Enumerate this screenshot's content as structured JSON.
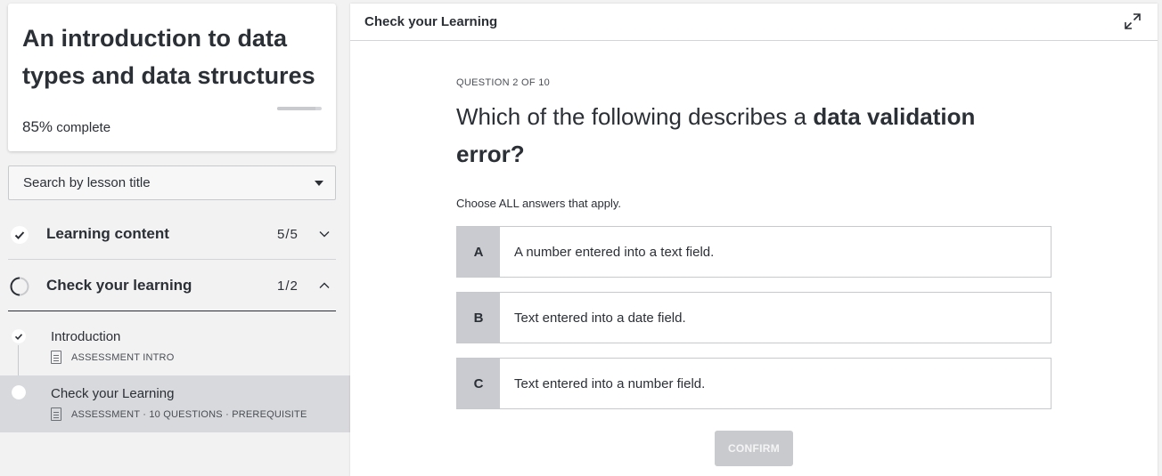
{
  "sidebar": {
    "course_title": "An introduction to data types and data structures",
    "progress_percent": 85,
    "progress_label_pct": "85%",
    "progress_label_text": "complete",
    "search_placeholder": "Search by lesson title",
    "sections": [
      {
        "label": "Learning content",
        "count": "5/5",
        "status": "complete",
        "expanded": false
      },
      {
        "label": "Check your learning",
        "count": "1/2",
        "status": "in-progress",
        "expanded": true
      }
    ],
    "lessons": [
      {
        "title": "Introduction",
        "meta": "ASSESSMENT INTRO",
        "status": "complete",
        "selected": false
      },
      {
        "title": "Check your Learning",
        "meta": "ASSESSMENT · 10 QUESTIONS · PREREQUISITE",
        "status": "current",
        "selected": true
      }
    ]
  },
  "main": {
    "header_title": "Check your Learning",
    "question_counter": "QUESTION 2 OF 10",
    "question_text_plain": "Which of the following describes a ",
    "question_text_bold": "data validation error?",
    "instruction": "Choose ALL answers that apply.",
    "options": [
      {
        "letter": "A",
        "text": "A number entered into a text field."
      },
      {
        "letter": "B",
        "text": "Text entered into a date field."
      },
      {
        "letter": "C",
        "text": "Text entered into a number field."
      }
    ],
    "confirm_label": "CONFIRM"
  },
  "icons": {
    "check": "check-icon",
    "in_progress": "progress-ring-icon",
    "chevron_down": "chevron-down-icon",
    "chevron_up": "chevron-up-icon",
    "caret": "caret-down-icon",
    "document": "document-icon",
    "expand": "expand-icon"
  },
  "colors": {
    "text": "#2b2f36",
    "option_letter_bg": "#c9cbd1",
    "selected_lesson_bg": "#d8d9dc",
    "confirm_disabled_bg": "#c9cacd"
  }
}
